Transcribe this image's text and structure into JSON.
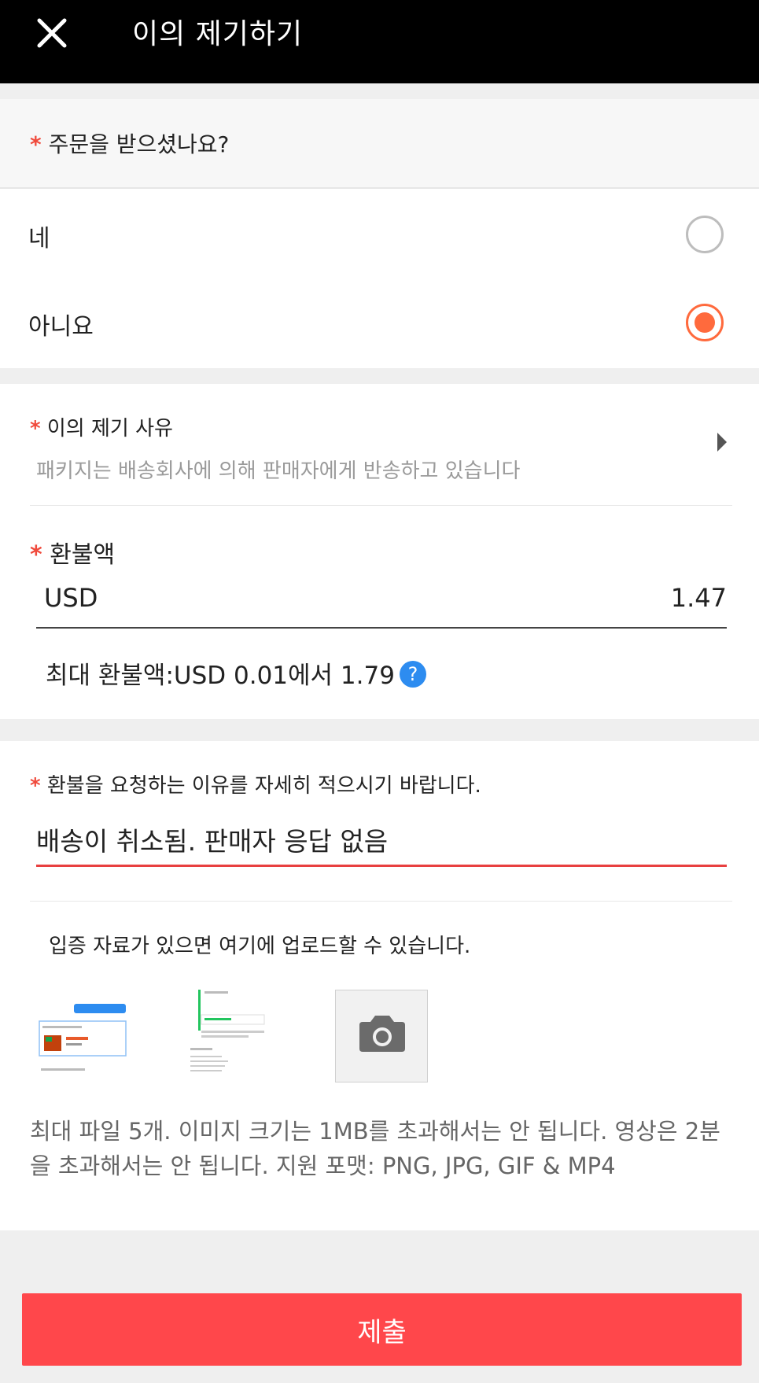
{
  "header": {
    "close_icon": "close-icon",
    "title": "이의 제기하기"
  },
  "received": {
    "required_mark": "*",
    "question": "주문을 받으셨나요?",
    "options": [
      {
        "label": "네",
        "selected": false
      },
      {
        "label": "아니요",
        "selected": true
      }
    ],
    "accent_color": "#ff6a3d"
  },
  "reason": {
    "required_mark": "*",
    "label": "이의 제기 사유",
    "value": "패키지는 배송회사에 의해 판매자에게 반송하고 있습니다",
    "arrow_icon": "chevron-right-icon"
  },
  "refund": {
    "required_mark": "*",
    "label": "환불액",
    "currency": "USD",
    "amount": "1.47",
    "max_text": "최대 환불액:USD 0.01에서 1.79",
    "help_icon_glyph": "?"
  },
  "details": {
    "required_mark": "*",
    "label": "환불을 요청하는 이유를 자세히 적으시기 바랍니다.",
    "value": "배송이 취소됨. 판매자 응답 없음",
    "underline_color": "#e84040"
  },
  "upload": {
    "label": "입증 자료가 있으면 여기에 업로드할 수 있습니다.",
    "camera_icon": "camera-icon",
    "note": "최대 파일 5개. 이미지 크기는 1MB를 초과해서는 안 됩니다. 영상은 2분을 초과해서는 안 됩니다. 지원 포맷: PNG, JPG, GIF & MP4"
  },
  "submit_label": "제출",
  "submit_color": "#ff474b"
}
